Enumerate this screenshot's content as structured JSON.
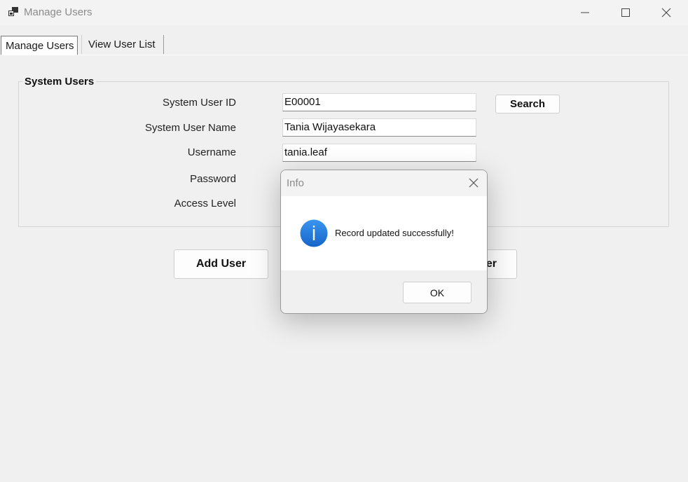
{
  "window": {
    "title": "Manage Users",
    "icons": {
      "app": "app-window-icon",
      "minimize": "minimize-icon",
      "maximize": "maximize-icon",
      "close": "close-icon"
    }
  },
  "tabs": [
    {
      "label": "Manage Users",
      "selected": true
    },
    {
      "label": "View User List",
      "selected": false
    }
  ],
  "form": {
    "group_title": "System Users",
    "labels": {
      "user_id": "System User ID",
      "user_name": "System User Name",
      "username": "Username",
      "password": "Password",
      "access_level": "Access Level"
    },
    "values": {
      "user_id": "E00001",
      "user_name": "Tania Wijayasekara",
      "username": "tania.leaf"
    },
    "search_label": "Search",
    "add_label": "Add User",
    "partial_button_label": "er"
  },
  "dialog": {
    "title": "Info",
    "message": "Record updated successfully!",
    "ok_label": "OK",
    "icon": "info-icon",
    "accent": "#1a73d8"
  }
}
